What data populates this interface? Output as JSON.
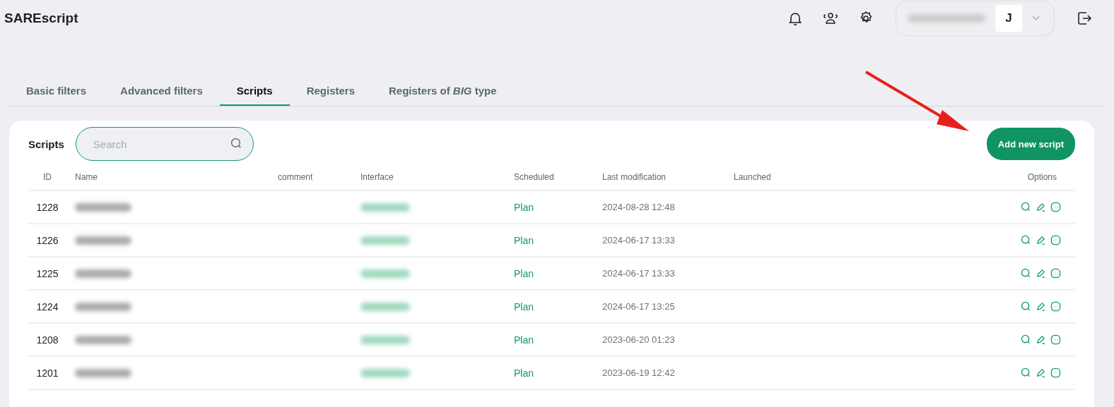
{
  "app": {
    "title": "SAREscript",
    "user_initial": "J"
  },
  "tabs": [
    {
      "label": "Basic filters",
      "selected": false
    },
    {
      "label": "Advanced filters",
      "selected": false
    },
    {
      "label": "Scripts",
      "selected": true
    },
    {
      "label": "Registers",
      "selected": false
    },
    {
      "label": "Registers of *BIG* type",
      "selected": false
    }
  ],
  "panel": {
    "title": "Scripts",
    "search": {
      "placeholder": "Search"
    },
    "add_button": "Add new script"
  },
  "table": {
    "columns": [
      "ID",
      "Name",
      "comment",
      "Interface",
      "Scheduled",
      "Last modification",
      "Launched",
      "Options"
    ],
    "rows": [
      {
        "id": "1228",
        "scheduled": "Plan",
        "modified": "2024-08-28 12:48"
      },
      {
        "id": "1226",
        "scheduled": "Plan",
        "modified": "2024-06-17 13:33"
      },
      {
        "id": "1225",
        "scheduled": "Plan",
        "modified": "2024-06-17 13:33"
      },
      {
        "id": "1224",
        "scheduled": "Plan",
        "modified": "2024-06-17 13:25"
      },
      {
        "id": "1208",
        "scheduled": "Plan",
        "modified": "2023-06-20 01:23"
      },
      {
        "id": "1201",
        "scheduled": "Plan",
        "modified": "2023-06-19 12:42"
      }
    ]
  }
}
